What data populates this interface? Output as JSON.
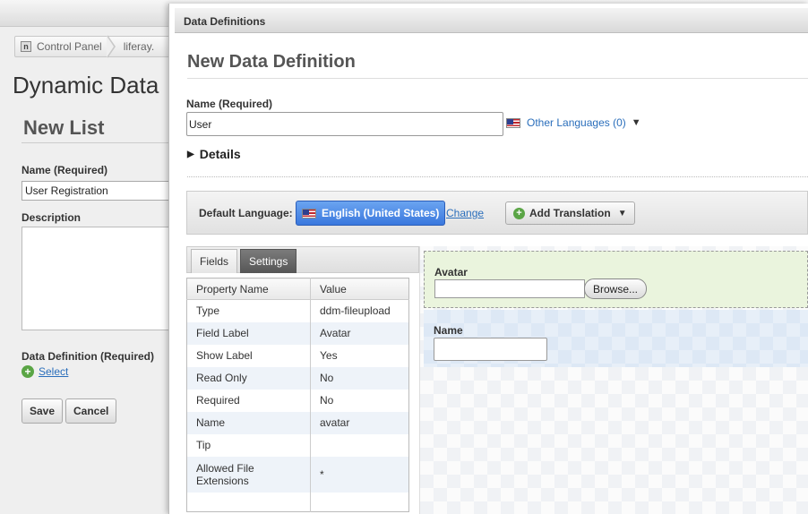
{
  "background": {
    "breadcrumb": [
      "Control Panel",
      "liferay."
    ],
    "title": "Dynamic Data",
    "subtitle": "New List",
    "name_label": "Name (Required)",
    "name_value": "User Registration",
    "description_label": "Description",
    "data_definition_label": "Data Definition (Required)",
    "select_label": "Select",
    "save_label": "Save",
    "cancel_label": "Cancel"
  },
  "dialog": {
    "title": "Data Definitions",
    "heading": "New Data Definition",
    "name_label": "Name (Required)",
    "name_value": "User",
    "other_languages": "Other Languages (0)",
    "details_label": "Details",
    "default_language_label": "Default Language:",
    "default_language": "English (United States)",
    "change_label": "Change",
    "add_translation_label": "Add Translation"
  },
  "panel": {
    "tabs": [
      "Fields",
      "Settings"
    ],
    "columns": [
      "Property Name",
      "Value"
    ],
    "rows": [
      [
        "Type",
        "ddm-fileupload"
      ],
      [
        "Field Label",
        "Avatar"
      ],
      [
        "Show Label",
        "Yes"
      ],
      [
        "Read Only",
        "No"
      ],
      [
        "Required",
        "No"
      ],
      [
        "Name",
        "avatar"
      ],
      [
        "Tip",
        ""
      ],
      [
        "Allowed File Extensions",
        "*"
      ]
    ]
  },
  "canvas": {
    "avatar_label": "Avatar",
    "browse_label": "Browse...",
    "name_label": "Name"
  },
  "icons": {
    "flag": "us-flag-icon",
    "plus": "add-circle-icon",
    "caret": "caret-down-icon",
    "triangle": "triangle-right-icon",
    "control_panel": "control-panel-icon"
  }
}
